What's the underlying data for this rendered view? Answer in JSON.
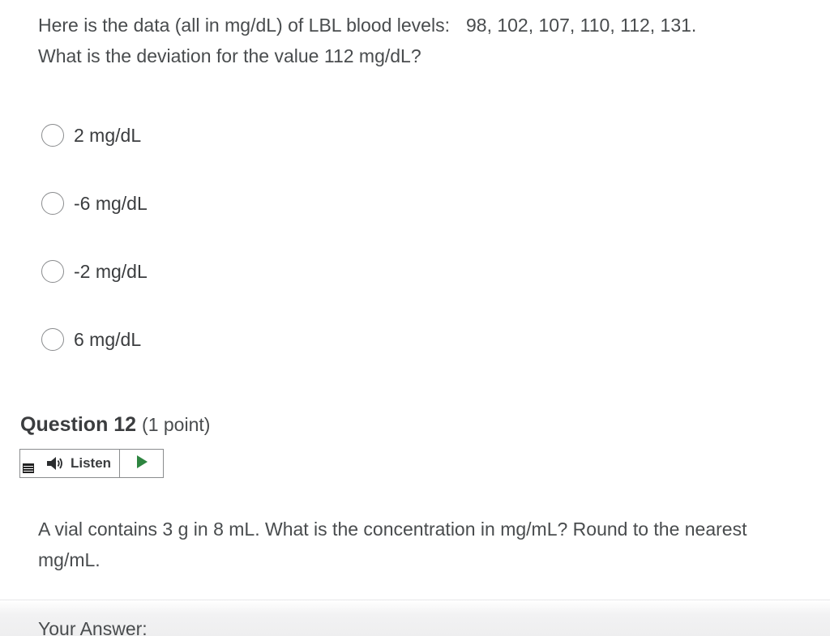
{
  "question11": {
    "text_line1": "Here is the data (all in mg/dL) of LBL blood levels:",
    "data_values": "98, 102, 107, 110, 112, 131.",
    "text_line2": "What is the deviation for the value 112 mg/dL?",
    "options": [
      {
        "label": "2 mg/dL",
        "selected": false
      },
      {
        "label": "-6 mg/dL",
        "selected": false
      },
      {
        "label": "-2 mg/dL",
        "selected": false
      },
      {
        "label": "6 mg/dL",
        "selected": false
      }
    ]
  },
  "question12": {
    "title": "Question 12",
    "points": "(1 point)",
    "listen": {
      "label": "Listen",
      "menu_icon": "menu-icon",
      "speaker_icon": "speaker-icon",
      "play_icon": "play-icon",
      "play_color": "#2e8540"
    },
    "text": "A vial contains 3 g in 8 mL.  What is the concentration in mg/mL? Round to the nearest mg/mL.",
    "answer_label": "Your Answer:"
  }
}
